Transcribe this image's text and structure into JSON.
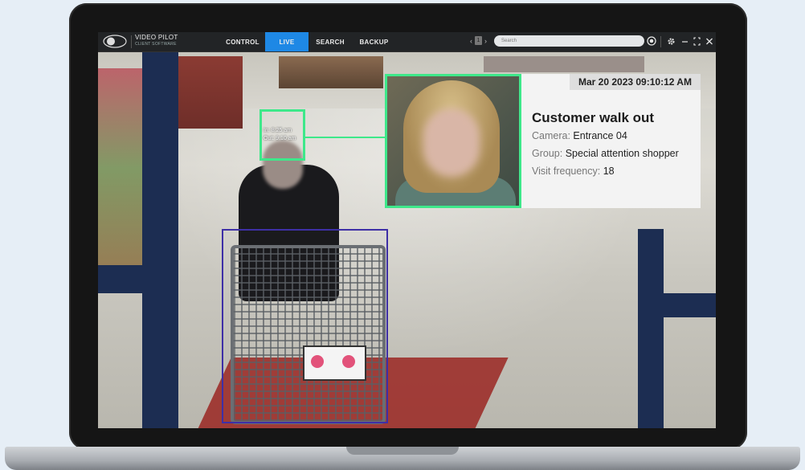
{
  "app": {
    "brand_name": "VIDEO PILOT",
    "brand_sub": "CLIENT SOFTWARE"
  },
  "nav": {
    "control": "CONTROL",
    "live": "LIVE",
    "search": "SEARCH",
    "backup": "BACKUP",
    "active": "LIVE"
  },
  "pager": {
    "prev": "‹",
    "page": "1",
    "next": "›"
  },
  "search": {
    "placeholder": "Search"
  },
  "face_box": {
    "in_time": "In: 8:25 am",
    "out_time": "Out: 9:10 am"
  },
  "alert": {
    "datetime": "Mar 20 2023 09:10:12 AM",
    "title": "Customer walk out",
    "camera_label": "Camera:",
    "camera_value": "Entrance 04",
    "group_label": "Group:",
    "group_value": "Special attention shopper",
    "visit_label": "Visit frequency:",
    "visit_value": "18"
  },
  "colors": {
    "accent": "#1e88e5",
    "detection_green": "#3ee88a",
    "cart_box": "#3e2fa6"
  },
  "icons": [
    "record-icon",
    "settings-gear-icon",
    "minimize-icon",
    "maximize-icon",
    "close-icon"
  ]
}
